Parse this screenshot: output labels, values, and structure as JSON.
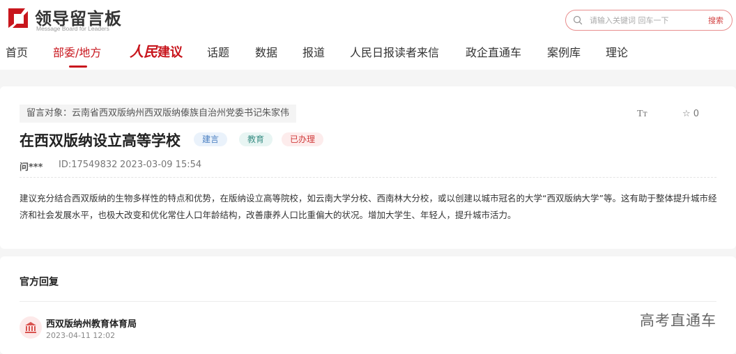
{
  "header": {
    "logo_title": "领导留言板",
    "logo_subtitle": "Message Board for Leaders",
    "search": {
      "placeholder": "请输入关键词 回车一下",
      "button_label": "搜索"
    }
  },
  "nav": {
    "items": [
      {
        "label": "首页"
      },
      {
        "label": "部委/地方"
      },
      {
        "label": "人民建议",
        "brand_script": "人民",
        "brand_rest": "建议"
      },
      {
        "label": "话题"
      },
      {
        "label": "数据"
      },
      {
        "label": "报道"
      },
      {
        "label": "人民日报读者来信"
      },
      {
        "label": "政企直通车"
      },
      {
        "label": "案例库"
      },
      {
        "label": "理论"
      }
    ],
    "active": "部委/地方"
  },
  "message": {
    "target": "留言对象：云南省西双版纳州西双版纳傣族自治州党委书记朱家伟",
    "font_tool_label": "Tт",
    "favorite_count": "0",
    "title": "在西双版纳设立高等学校",
    "tags": [
      {
        "label": "建言",
        "color": "#4a7fc1"
      },
      {
        "label": "教育",
        "color": "#3b8f85"
      },
      {
        "label": "已办理",
        "color": "#d03a3a"
      }
    ],
    "author": "问***",
    "id_text": "ID:17549832",
    "datetime": "2023-03-09 15:54",
    "content": "建议充分结合西双版纳的生物多样性的特点和优势，在版纳设立高等院校，如云南大学分校、西南林大分校，或以创建以城市冠名的大学“西双版纳大学”等。这有助于整体提升城市经济和社会发展水平，也极大改变和优化常住人口年龄结构，改善康养人口比重偏大的状况。增加大学生、年轻人，提升城市活力。"
  },
  "reply": {
    "section_title": "官方回复",
    "org_name": "西双版纳州教育体育局",
    "date": "2023-04-11 12:02"
  },
  "watermark": "高考直通车"
}
